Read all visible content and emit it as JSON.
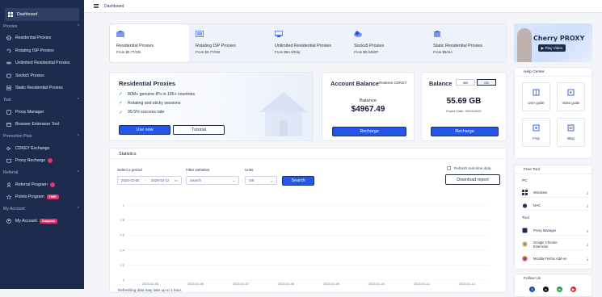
{
  "sidebar": {
    "items": [
      {
        "label": "Dashboard",
        "icon": "dashboard-icon"
      },
      {
        "section": "Proxies"
      },
      {
        "label": "Residential Proxies",
        "icon": "globe-icon"
      },
      {
        "label": "Rotating ISP Proxies",
        "icon": "rotate-icon"
      },
      {
        "label": "Unlimited Residential Proxies",
        "icon": "infinity-icon"
      },
      {
        "label": "Socks5 Proxies",
        "icon": "socks-icon"
      },
      {
        "label": "Static Residential Proxies",
        "icon": "server-icon"
      },
      {
        "section": "Tool"
      },
      {
        "label": "Proxy Manager",
        "icon": "manager-icon"
      },
      {
        "label": "Browser Extension Tool",
        "icon": "extension-icon"
      },
      {
        "section": "Promotion Plan"
      },
      {
        "label": "CDKEY Exchange",
        "icon": "key-icon"
      },
      {
        "label": "Proxy Recharge",
        "icon": "wallet-icon"
      },
      {
        "section": "Referral"
      },
      {
        "label": "Referral Program",
        "icon": "referral-icon"
      },
      {
        "label": "Points Program",
        "icon": "points-icon",
        "badge": "TIME"
      },
      {
        "section": "My Account"
      },
      {
        "label": "My Account",
        "icon": "user-icon",
        "badge": "Coupons"
      }
    ]
  },
  "topbar": {
    "breadcrumb": "Dashboard"
  },
  "products": [
    {
      "name": "Residential Proxies",
      "price": "From $0.77/GB"
    },
    {
      "name": "Rotating ISP Proxies",
      "price": "From $0.77/GB"
    },
    {
      "name": "Unlimited Residential Proxies",
      "price": "From $84.3/Day"
    },
    {
      "name": "Socks5 Proxies",
      "price": "From $0.045/IP"
    },
    {
      "name": "Static Residential Proxies",
      "price": "From $5/mo"
    }
  ],
  "video": {
    "title": "Cherry PROXY",
    "button": "Play Video"
  },
  "residential": {
    "title": "Residential Proxies",
    "features": [
      "80M+ genuine IPs in 195+ countries",
      "Rotating and sticky sessions",
      "99.5% success rate"
    ],
    "use_now": "Use now",
    "tutorial": "Tutorial"
  },
  "account": {
    "title": "Account Balance",
    "redeem": "Redeem CDKEY",
    "balance_label": "Balance",
    "balance_value": "$4967.49",
    "recharge": "Recharge"
  },
  "balance": {
    "title": "Balance",
    "toggle": [
      "MB",
      "GB"
    ],
    "value": "55.69 GB",
    "expire": "Expire Date: 30/03/2025",
    "recharge": "Recharge"
  },
  "stats": {
    "title": "Statistics",
    "period_label": "Select a period",
    "date_from": "2025-02-05",
    "date_sep": "-",
    "date_to": "2025-02-12",
    "filter_label": "Filter websites",
    "filter_placeholder": "Search",
    "units_label": "Units",
    "units_value": "GB",
    "search": "Search",
    "realtime": "Refresh real-time data",
    "download": "Download report",
    "note": "Refreshing data may take up to 1 hour."
  },
  "chart_data": {
    "type": "line",
    "x": [
      "2025-02-05",
      "2025-02-06",
      "2025-02-07",
      "2025-02-08",
      "2025-02-09",
      "2025-02-10",
      "2025-02-11",
      "2025-02-12"
    ],
    "yticks": [
      "1",
      "0.8",
      "0.6",
      "0.4",
      "0.2",
      "0"
    ],
    "ylim": [
      0,
      1
    ]
  },
  "help": {
    "title": "Help Center",
    "items": [
      "User guide",
      "Video guide",
      "FAQ",
      "Blog"
    ]
  },
  "tools": {
    "title": "Free Tool",
    "pc_label": "PC",
    "pc_items": [
      "Windows",
      "MAC"
    ],
    "tool_label": "Tool",
    "tool_items": [
      "Proxy Manager",
      "Google Chrome Extension",
      "Mozilla Firefox Add-on"
    ]
  },
  "follow": {
    "title": "Follow Us"
  },
  "colors": {
    "sidebar": "#1d2b4f",
    "primary": "#2656e6",
    "accent": "#e4346f"
  }
}
